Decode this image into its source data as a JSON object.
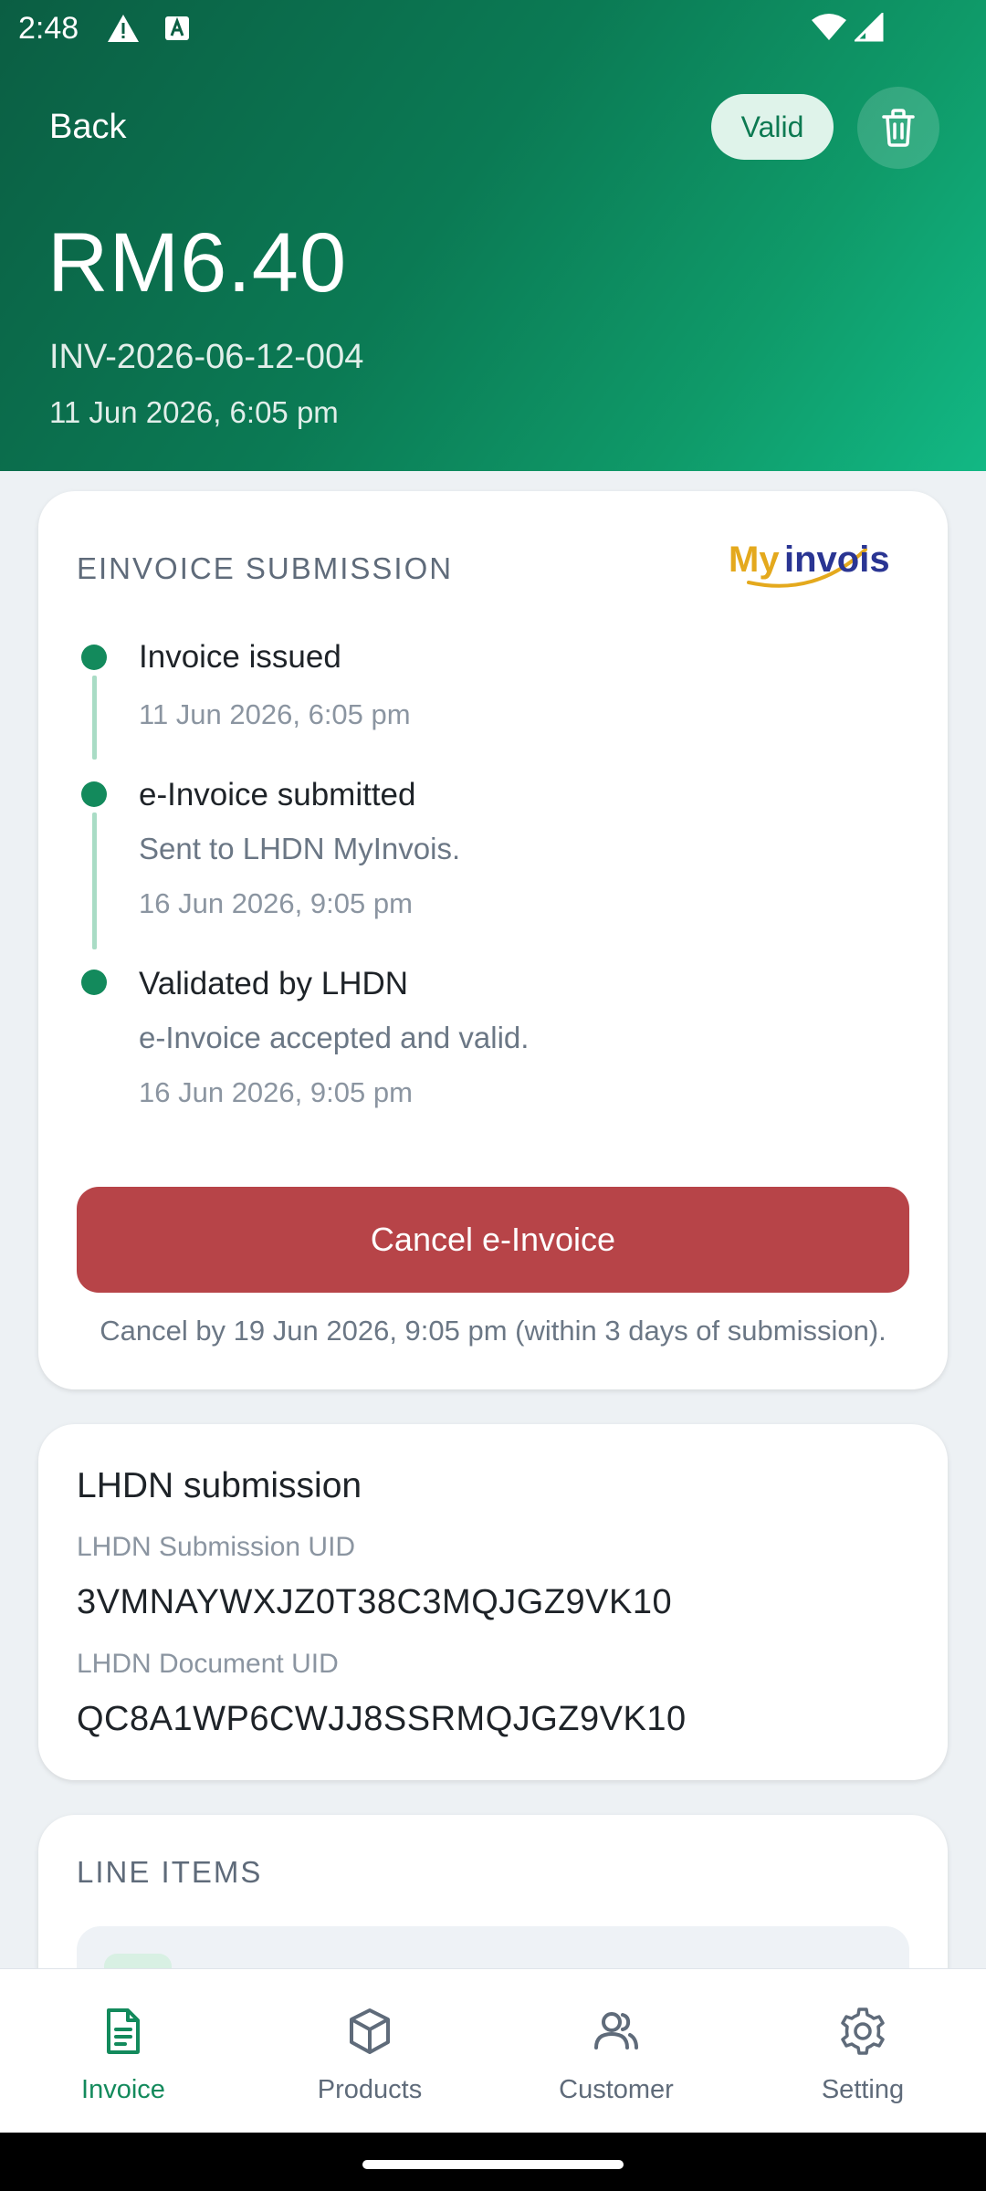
{
  "status_bar": {
    "time": "2:48",
    "icons": [
      "warning-icon",
      "keyboard-a-icon",
      "wifi-icon",
      "signal-icon"
    ]
  },
  "header": {
    "back_label": "Back",
    "status_badge": "Valid",
    "delete_icon": "trash-icon",
    "amount": "RM6.40",
    "invoice_number": "INV-2026-06-12-004",
    "invoice_datetime": "11 Jun 2026, 6:05 pm"
  },
  "submission": {
    "section_title": "EINVOICE SUBMISSION",
    "logo_text": {
      "part1": "My",
      "part2": "invois"
    },
    "timeline": [
      {
        "title": "Invoice issued",
        "description": "",
        "time": "11 Jun 2026, 6:05 pm"
      },
      {
        "title": "e-Invoice submitted",
        "description": "Sent to LHDN MyInvois.",
        "time": "16 Jun 2026, 9:05 pm"
      },
      {
        "title": "Validated by LHDN",
        "description": "e-Invoice accepted and valid.",
        "time": "16 Jun 2026, 9:05 pm"
      }
    ],
    "cancel_button_label": "Cancel e-Invoice",
    "cancel_note": "Cancel by 19 Jun 2026, 9:05 pm (within 3 days of submission)."
  },
  "lhdn": {
    "heading": "LHDN submission",
    "submission_uid_label": "LHDN Submission UID",
    "submission_uid": "3VMNAYWXJZ0T38C3MQJGZ9VK10",
    "document_uid_label": "LHDN Document UID",
    "document_uid": "QC8A1WP6CWJJ8SSRMQJGZ9VK10"
  },
  "line_items": {
    "section_title": "LINE ITEMS"
  },
  "bottom_nav": {
    "items": [
      {
        "label": "Invoice",
        "icon": "document-icon",
        "active": true
      },
      {
        "label": "Products",
        "icon": "box-icon",
        "active": false
      },
      {
        "label": "Customer",
        "icon": "users-icon",
        "active": false
      },
      {
        "label": "Setting",
        "icon": "gear-icon",
        "active": false
      }
    ]
  },
  "colors": {
    "brand_green": "#138a5c",
    "header_gradient_start": "#0b5e43",
    "header_gradient_end": "#12b884",
    "danger": "#b74448",
    "valid_badge_bg": "#dff3ea"
  }
}
